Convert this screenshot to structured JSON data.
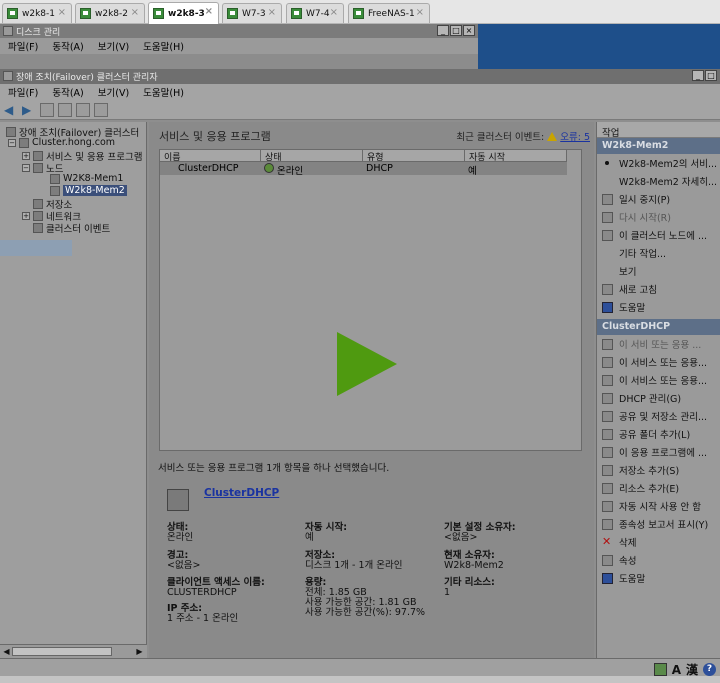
{
  "tabs": [
    {
      "label": "w2k8-1",
      "close": "×"
    },
    {
      "label": "w2k8-2",
      "close": "×"
    },
    {
      "label": "w2k8-3",
      "close": "×"
    },
    {
      "label": "W7-3",
      "close": "×"
    },
    {
      "label": "W7-4",
      "close": "×"
    },
    {
      "label": "FreeNAS-1",
      "close": "×"
    }
  ],
  "disk_window": {
    "title": "디스크 관리",
    "menu": [
      "파일(F)",
      "동작(A)",
      "보기(V)",
      "도움말(H)"
    ]
  },
  "cluster_window": {
    "title": "장애 조치(Failover) 클러스터 관리자",
    "menu": [
      "파일(F)",
      "동작(A)",
      "보기(V)",
      "도움말(H)"
    ]
  },
  "tree": {
    "root": "장애 조치(Failover) 클러스터",
    "cluster": "Cluster.hong.com",
    "services": "서비스 및 응용 프로그램",
    "nodes": "노드",
    "node1": "W2K8-Mem1",
    "node2": "W2k8-Mem2",
    "storage": "저장소",
    "network": "네트워크",
    "events": "클러스터 이벤트"
  },
  "center": {
    "header": "서비스 및 응용 프로그램",
    "events_label": "최근 클러스터 이벤트:",
    "events_link": "오류: 5",
    "columns": [
      "이름",
      "상태",
      "유형",
      "자동 시작"
    ],
    "rows": [
      {
        "name": "ClusterDHCP",
        "status": "온라인",
        "type": "DHCP",
        "autostart": "예"
      }
    ],
    "selection_info": "서비스 또는 응용 프로그램 1개 항목을 하나 선택했습니다.",
    "detail_name": "ClusterDHCP",
    "details": {
      "status_label": "상태:",
      "status_value": "온라인",
      "autostart_label": "자동 시작:",
      "autostart_value": "예",
      "default_owner_label": "기본 설정 소유자:",
      "default_owner_value": "<없음>",
      "alert_label": "경고:",
      "alert_value": "<없음>",
      "storage_label": "저장소:",
      "storage_value": "디스크 1개 - 1개 온라인",
      "current_owner_label": "현재 소유자:",
      "current_owner_value": "W2k8-Mem2",
      "client_access_label": "클라이언트 액세스 이름:",
      "client_access_value": "CLUSTERDHCP",
      "capacity_label": "용량:",
      "capacity_total": "전체: 1.85 GB",
      "capacity_free": "사용 가능한 공간: 1.81 GB",
      "capacity_pct": "사용 가능한 공간(%): 97.7%",
      "other_resources_label": "기타 리소스:",
      "other_resources_value": "1",
      "ip_label": "IP 주소:",
      "ip_value": "1 주소 - 1 온라인"
    }
  },
  "actions": {
    "title": "작업",
    "section1": "W2k8-Mem2",
    "section1_items": [
      "W2k8-Mem2의 서비...",
      "W2k8-Mem2 자세히...",
      "일시 중지(P)",
      "다시 시작(R)",
      "이 클러스터 노드에 ...",
      "기타 작업...",
      "보기",
      "새로 고침",
      "도움말"
    ],
    "section2": "ClusterDHCP",
    "section2_items": [
      "이 서비 또는 응용 ...",
      "이 서비스 또는 응용...",
      "이 서비스 또는 응용...",
      "DHCP 관리(G)",
      "공유 및 저장소 관리...",
      "공유 폴더 추가(L)",
      "이 응용 프로그램에 ...",
      "저장소 추가(S)",
      "리소스 추가(E)",
      "자동 시작 사용 안 함",
      "종속성 보고서 표시(Y)",
      "삭제",
      "속성",
      "도움말"
    ]
  },
  "status_icons": {
    "lang_a": "A",
    "lang_han": "漢",
    "help": "?"
  },
  "window_buttons": {
    "min": "_",
    "max": "□",
    "close": "×"
  },
  "tree_toggles": {
    "minus": "−",
    "plus": "+"
  },
  "scroll_arrows": {
    "left": "◀",
    "right": "▶"
  },
  "toolbar_arrows": {
    "back": "◀",
    "forward": "▶"
  },
  "play_color": "#4f9a10",
  "section_header_color": "#5d6f88"
}
